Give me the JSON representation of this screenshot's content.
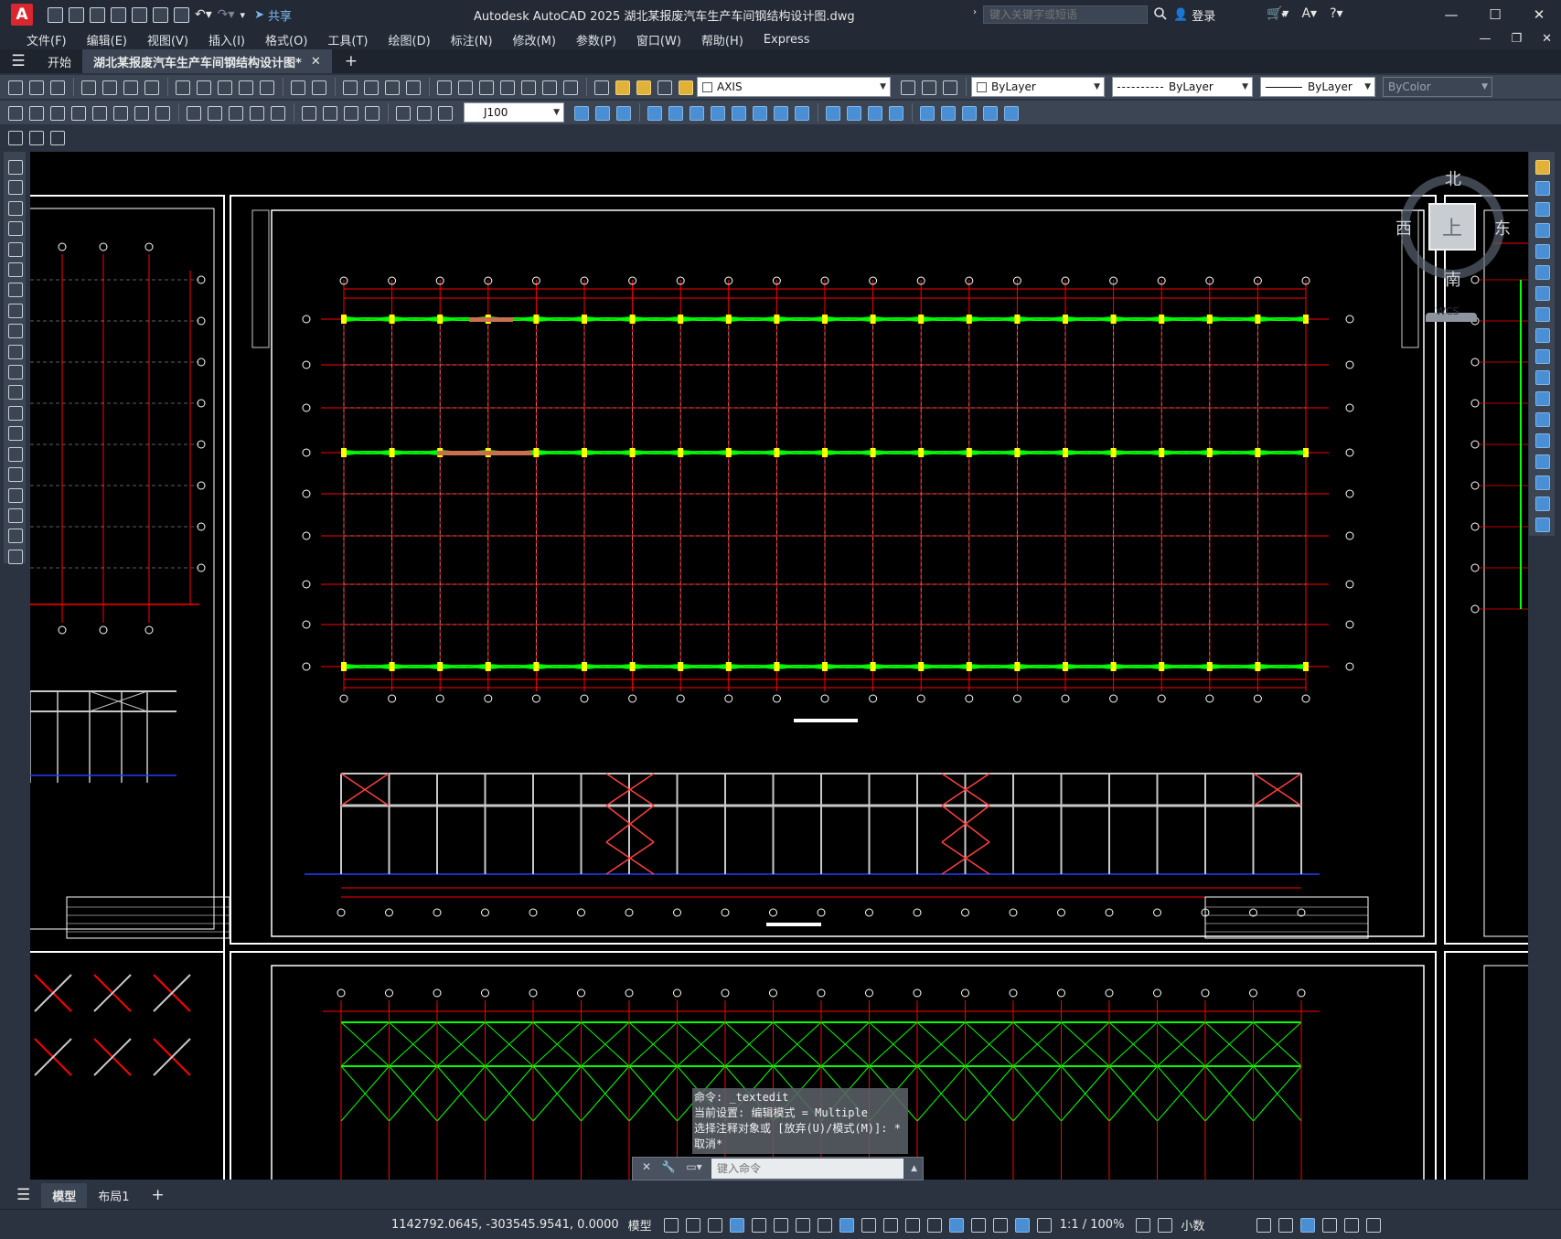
{
  "app": {
    "title": "Autodesk AutoCAD 2025    湖北某报废汽车生产车间钢结构设计图.dwg",
    "logo_letter": "A",
    "share_label": "共享",
    "search_placeholder": "键入关键字或短语",
    "login_label": "登录"
  },
  "menu": [
    "文件(F)",
    "编辑(E)",
    "视图(V)",
    "插入(I)",
    "格式(O)",
    "工具(T)",
    "绘图(D)",
    "标注(N)",
    "修改(M)",
    "参数(P)",
    "窗口(W)",
    "帮助(H)",
    "Express"
  ],
  "tabs": {
    "start": "开始",
    "active": "湖北某报废汽车生产车间钢结构设计图*"
  },
  "layer": {
    "current": "AXIS",
    "color": "ByLayer",
    "linetype": "ByLayer",
    "lineweight": "ByLayer",
    "plotstyle": "ByColor"
  },
  "dimstyle": "J100",
  "viewcube": {
    "north": "北",
    "south": "南",
    "east": "东",
    "west": "西",
    "top": "上",
    "wcs": "WCS"
  },
  "command": {
    "history": [
      "命令: _textedit",
      "当前设置: 编辑模式 = Multiple",
      "选择注释对象或 [放弃(U)/模式(M)]: *",
      "取消*"
    ],
    "placeholder": "键入命令"
  },
  "layouts": [
    "模型",
    "布局1"
  ],
  "status": {
    "coords": "1142792.0645, -303545.9541, 0.0000",
    "model": "模型",
    "scale": "1:1 / 100%",
    "units": "小数"
  },
  "colors": {
    "grid_red": "#ff0000",
    "beam_green": "#00ff00",
    "bracing_red": "#ff4040",
    "column_gray": "#c8c8c8",
    "dim_white": "#ffffff",
    "ground_blue": "#2040ff"
  }
}
